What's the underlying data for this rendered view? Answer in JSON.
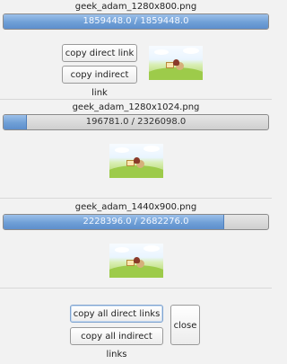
{
  "items": [
    {
      "filename": "geek_adam_1280x800.png",
      "progress_text": "1859448.0 / 1859448.0",
      "progress_fraction": 1.0
    },
    {
      "filename": "geek_adam_1280x1024.png",
      "progress_text": "196781.0 / 2326098.0",
      "progress_fraction": 0.0846
    },
    {
      "filename": "geek_adam_1440x900.png",
      "progress_text": "2228396.0 / 2682276.0",
      "progress_fraction": 0.8308
    }
  ],
  "item0_buttons": {
    "copy_direct": "copy direct link",
    "copy_indirect": "copy indirect link"
  },
  "footer": {
    "copy_all_direct": "copy all direct links",
    "copy_all_indirect": "copy all indirect links",
    "close": "close"
  }
}
